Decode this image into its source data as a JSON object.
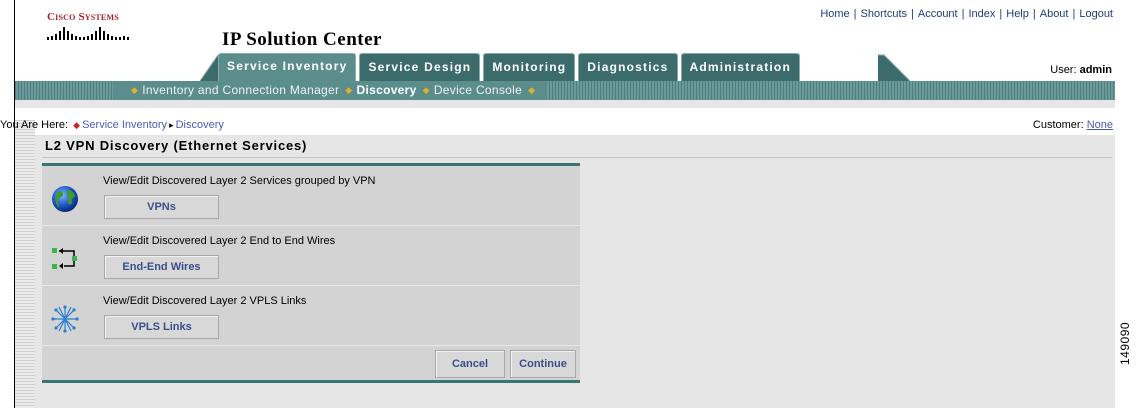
{
  "brand": {
    "logo_text": "Cisco Systems"
  },
  "app": {
    "title": "IP Solution Center"
  },
  "utility_links": [
    "Home",
    "Shortcuts",
    "Account",
    "Index",
    "Help",
    "About",
    "Logout"
  ],
  "user": {
    "label": "User:",
    "name": "admin"
  },
  "tabs": [
    {
      "label": "Service Inventory",
      "active": true
    },
    {
      "label": "Service Design",
      "active": false
    },
    {
      "label": "Monitoring",
      "active": false
    },
    {
      "label": "Diagnostics",
      "active": false
    },
    {
      "label": "Administration",
      "active": false
    }
  ],
  "subnav": [
    {
      "label": "Inventory and Connection Manager",
      "current": false
    },
    {
      "label": "Discovery",
      "current": true
    },
    {
      "label": "Device Console",
      "current": false
    }
  ],
  "breadcrumb": {
    "prefix": "You Are Here:",
    "items": [
      "Service Inventory",
      "Discovery"
    ]
  },
  "customer": {
    "label": "Customer:",
    "value": "None"
  },
  "page": {
    "heading": "L2 VPN Discovery (Ethernet Services)"
  },
  "rows": [
    {
      "icon": "globe-icon",
      "description": "View/Edit Discovered Layer 2 Services grouped by VPN",
      "button": "VPNs"
    },
    {
      "icon": "end-to-end-wires-icon",
      "description": "View/Edit Discovered Layer 2 End to End Wires",
      "button": "End-End Wires"
    },
    {
      "icon": "vpls-links-icon",
      "description": "View/Edit Discovered Layer 2 VPLS Links",
      "button": "VPLS Links"
    }
  ],
  "footer_buttons": {
    "cancel": "Cancel",
    "continue": "Continue"
  },
  "figure_number": "149090",
  "colors": {
    "tab_bg": "#3c6b6b",
    "tab_active": "#5c8d8d",
    "link": "#4a5cb7",
    "brand_red": "#a81d2b",
    "panel_border": "#3e7373"
  }
}
